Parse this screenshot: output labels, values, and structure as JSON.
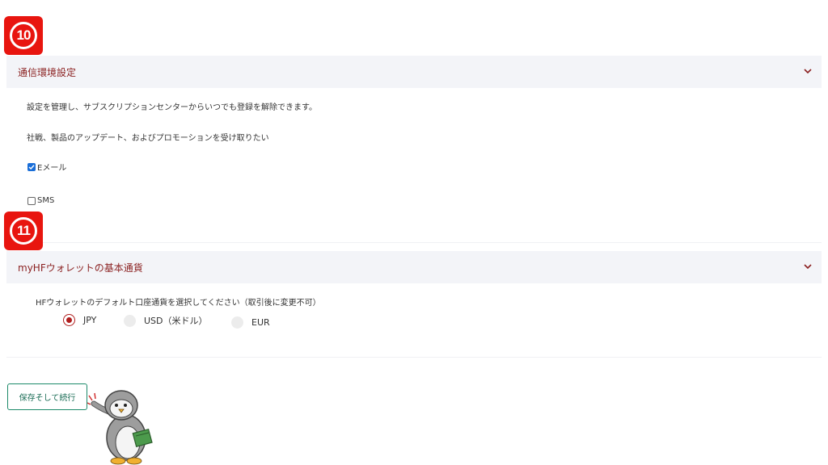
{
  "badges": {
    "step10": "10",
    "step11": "11"
  },
  "comm_section": {
    "title": "通信環境設定",
    "manage_text": "設定を管理し、サブスクリプションセンターからいつでも登録を解除できます。",
    "receive_text": "社戦、製品のアップデート、およびプロモーションを受け取りたい",
    "options": [
      {
        "label": "Eメール",
        "checked": true
      },
      {
        "label": "SMS",
        "checked": false
      }
    ]
  },
  "currency_section": {
    "title": "myHFウォレットの基本通貨",
    "prompt": "HFウォレットのデフォルト口座通貨を選択してください（取引後に変更不可）",
    "options": [
      {
        "label": "JPY",
        "selected": true
      },
      {
        "label": "USD（米ドル）",
        "selected": false
      },
      {
        "label": "EUR",
        "selected": false
      }
    ]
  },
  "save_button": "保存そして続行",
  "colors": {
    "badge": "#e8150f",
    "header_text": "#8a1f1f",
    "button_border": "#1d8a6a",
    "radio_selected": "#b01e1e",
    "checkbox": "#1a6ed8"
  },
  "icons": [
    "chevron-down-icon",
    "check-icon",
    "penguin-mascot"
  ]
}
